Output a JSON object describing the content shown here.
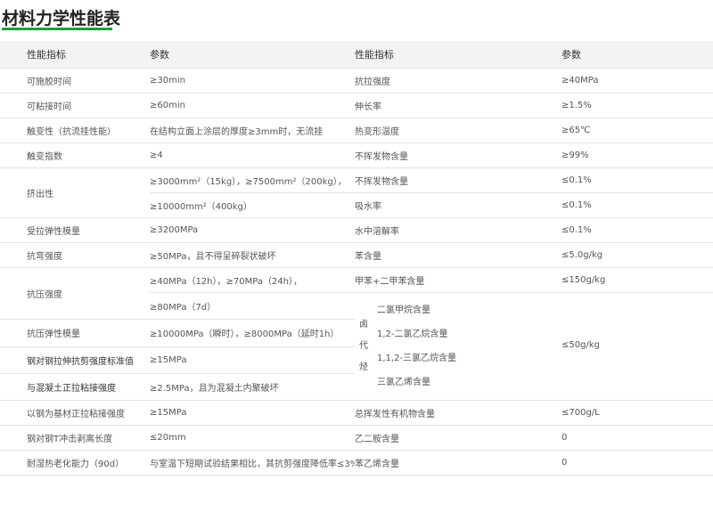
{
  "page": {
    "title": "材料力学性能表"
  },
  "table": {
    "headers": [
      "性能指标",
      "参数",
      "性能指标",
      "参数"
    ],
    "rows": [
      [
        "可施胶时间",
        "≥30min",
        "抗拉强度",
        "≥40MPa"
      ],
      [
        "可粘接时间",
        "≥60min",
        "伸长率",
        "≥1.5%"
      ],
      [
        "触变性（抗流挂性能）",
        "在结构立面上涂层的厚度≥3mm时，无流挂",
        "热变形温度",
        "≥65℃"
      ],
      [
        "触变指数",
        "≥4",
        "不挥发物含量",
        "≥99%"
      ],
      [
        "挤出性",
        "≥3000mm²（15kg），≥7500mm²（200kg），",
        "不挥发物含量",
        "≤0.1%"
      ],
      [
        "",
        "≥10000mm²（400kg）",
        "吸水率",
        "≤0.1%"
      ],
      [
        "受拉弹性模量",
        "≥3200MPa",
        "水中溶解率",
        "≤0.1%"
      ],
      [
        "抗弯强度",
        "≥50MPa，且不得呈碎裂状破坏",
        "苯含量",
        "≤5.0g/kg"
      ],
      [
        "抗压强度",
        "≥40MPa（12h），≥70MPa（24h），",
        "甲苯+二甲苯含量",
        "≤150g/kg"
      ],
      [
        "",
        "≥80MPa（7d）",
        "",
        ""
      ],
      [
        "抗压弹性模量",
        "≥10000MPa（瞬时），≥8000MPa（延时1h）",
        "",
        ""
      ],
      [
        "钢对钢拉伸抗剪强度标准值",
        "≥15MPa",
        "",
        ""
      ],
      [
        "与混凝土正拉粘接强度",
        "≥2.5MPa，且为混凝土内聚破坏",
        "",
        ""
      ],
      [
        "以钢为基材正拉粘接强度",
        "≥15MPa",
        "总挥发性有机物含量",
        "≤700g/L"
      ],
      [
        "钢对钢T冲击剥离长度",
        "≤20mm",
        "乙二胺含量",
        "0"
      ],
      [
        "耐湿热老化能力（90d）",
        "与室温下短期试验结果相比，其抗剪强度降低率≤3%",
        "苯乙烯含量",
        "0"
      ]
    ],
    "halo_group": {
      "label_chars": [
        "卤",
        "代",
        "烃"
      ],
      "items": [
        "二氯甲烷含量",
        "1,2-二氯乙烷含量",
        "1,1,2-三氯乙烷含量",
        "三氯乙烯含量"
      ],
      "value": "≤50g/kg"
    }
  }
}
